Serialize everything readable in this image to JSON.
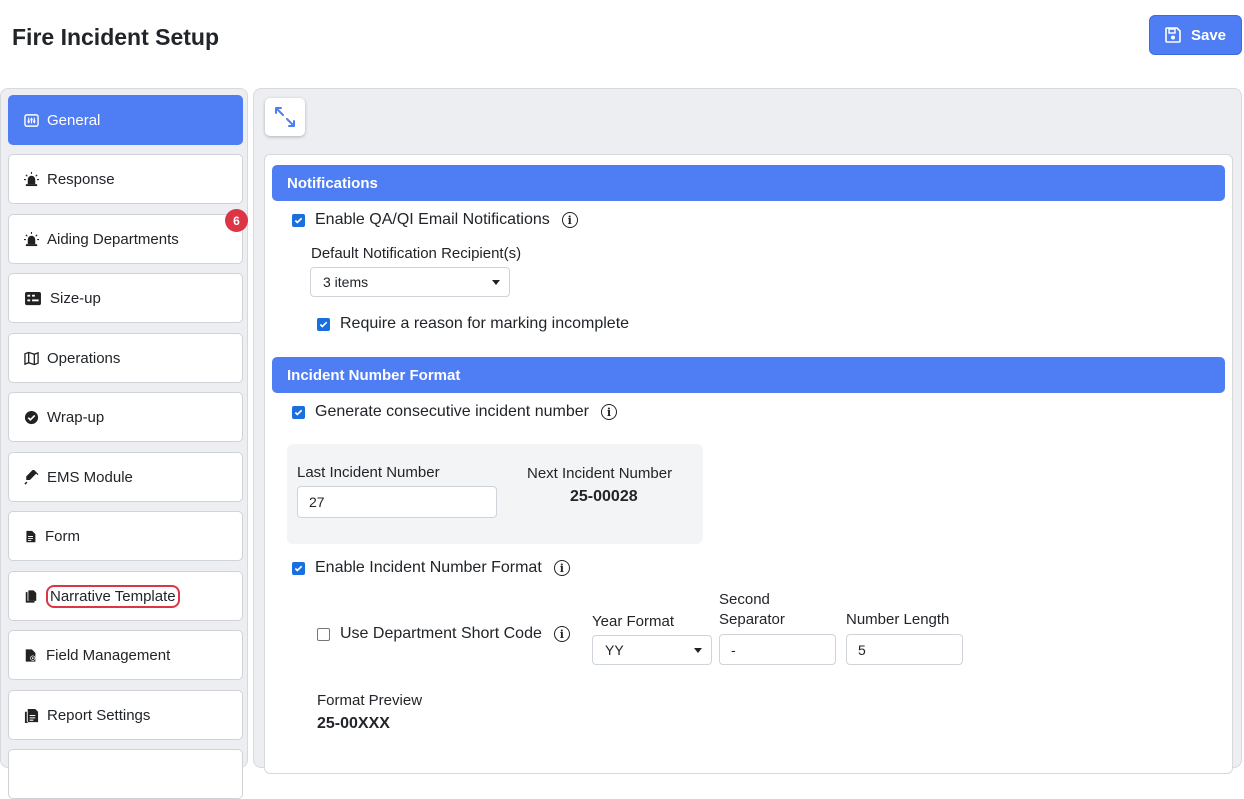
{
  "header": {
    "title": "Fire Incident Setup",
    "save_label": "Save"
  },
  "sidebar": {
    "items": [
      {
        "label": "General",
        "icon": "sliders-icon",
        "active": true
      },
      {
        "label": "Response",
        "icon": "siren-icon"
      },
      {
        "label": "Aiding Departments",
        "icon": "siren-icon",
        "badge": "6"
      },
      {
        "label": "Size-up",
        "icon": "dashboard-icon"
      },
      {
        "label": "Operations",
        "icon": "map-icon"
      },
      {
        "label": "Wrap-up",
        "icon": "check-circle-icon"
      },
      {
        "label": "EMS Module",
        "icon": "syringe-icon"
      },
      {
        "label": "Form",
        "icon": "file-icon"
      },
      {
        "label": "Narrative Template",
        "icon": "copy-icon"
      },
      {
        "label": "Field Management",
        "icon": "file-gear-icon"
      },
      {
        "label": "Report Settings",
        "icon": "report-icon"
      }
    ]
  },
  "notifications": {
    "title": "Notifications",
    "enable_qa_label": "Enable QA/QI Email Notifications",
    "enable_qa_checked": true,
    "recipient_label": "Default Notification Recipient(s)",
    "recipient_value": "3 items",
    "require_reason_label": "Require a reason for marking incomplete",
    "require_reason_checked": true
  },
  "incident_number": {
    "title": "Incident Number Format",
    "generate_label": "Generate consecutive incident number",
    "generate_checked": true,
    "last_label": "Last Incident Number",
    "last_value": "27",
    "next_label": "Next Incident Number",
    "next_value": "25-00028",
    "enable_format_label": "Enable Incident Number Format",
    "enable_format_checked": true,
    "short_code_label": "Use Department Short Code",
    "short_code_checked": false,
    "year_format_label": "Year Format",
    "year_format_value": "YY",
    "second_sep_label_1": "Second",
    "second_sep_label_2": "Separator",
    "second_sep_value": "-",
    "number_length_label": "Number Length",
    "number_length_value": "5",
    "preview_label": "Format Preview",
    "preview_value": "25-00XXX"
  },
  "colors": {
    "accent": "#4f7df3",
    "badge": "#dc3545",
    "checkbox": "#1a6fe0"
  }
}
